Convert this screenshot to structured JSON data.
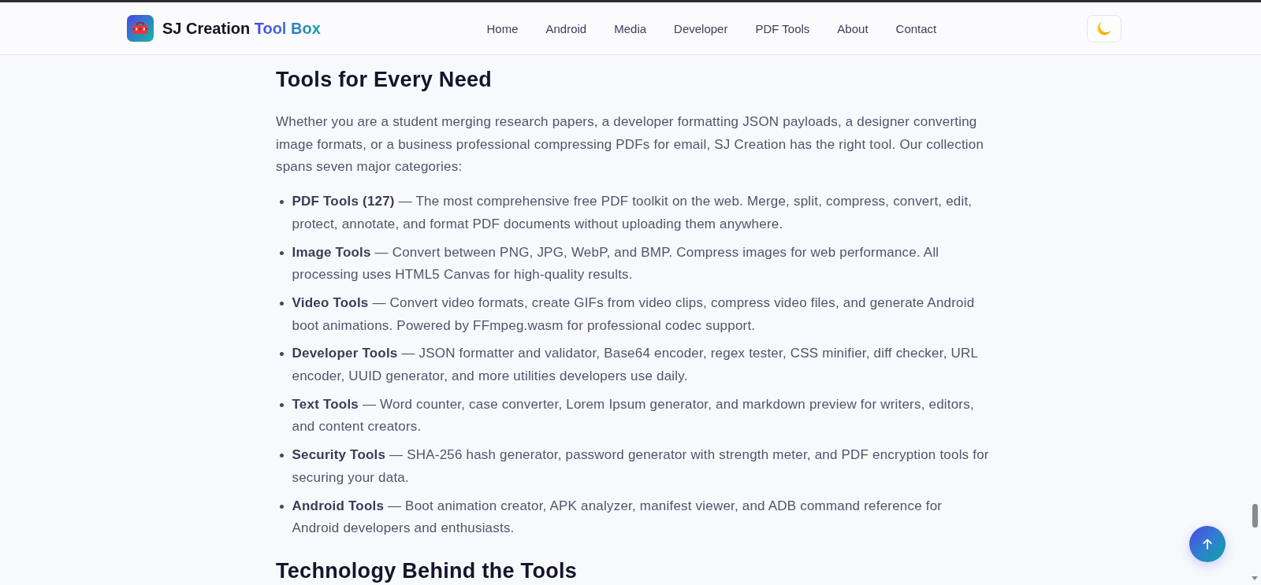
{
  "header": {
    "brand": {
      "name": "SJ Creation",
      "accent": "Tool Box"
    },
    "nav": [
      {
        "label": "Home"
      },
      {
        "label": "Android"
      },
      {
        "label": "Media"
      },
      {
        "label": "Developer"
      },
      {
        "label": "PDF Tools"
      },
      {
        "label": "About"
      },
      {
        "label": "Contact"
      }
    ]
  },
  "sections": [
    {
      "heading": "Tools for Every Need",
      "paragraph": "Whether you are a student merging research papers, a developer formatting JSON payloads, a designer converting image formats, or a business professional compressing PDFs for email, SJ Creation has the right tool. Our collection spans seven major categories:",
      "items": [
        "**PDF Tools (127)** — The most comprehensive free PDF toolkit on the web. Merge, split, compress, convert, edit, protect, annotate, and format PDF documents without uploading them anywhere.",
        "**Image Tools** — Convert between PNG, JPG, WebP, and BMP. Compress images for web performance. All processing uses HTML5 Canvas for high-quality results.",
        "**Video Tools** — Convert video formats, create GIFs from video clips, compress video files, and generate Android boot animations. Powered by FFmpeg.wasm for professional codec support.",
        "**Developer Tools** — JSON formatter and validator, Base64 encoder, regex tester, CSS minifier, diff checker, URL encoder, UUID generator, and more utilities developers use daily.",
        "**Text Tools** — Word counter, case converter, Lorem Ipsum generator, and markdown preview for writers, editors, and content creators.",
        "**Security Tools** — SHA-256 hash generator, password generator with strength meter, and PDF encryption tools for securing your data.",
        "**Android Tools** — Boot animation creator, APK analyzer, manifest viewer, and ADB command reference for Android developers and enthusiasts."
      ]
    },
    {
      "heading": "Technology Behind the Tools"
    }
  ]
}
